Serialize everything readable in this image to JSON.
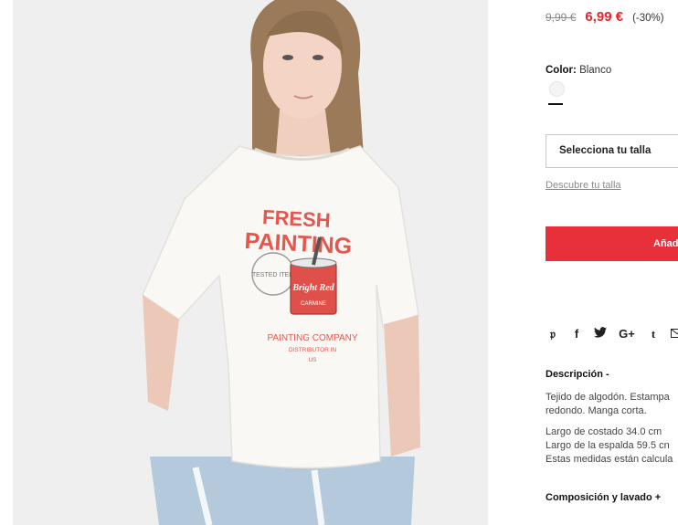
{
  "product": {
    "image_alt": "Camiseta blanca estampada Fresh Painting",
    "print_text": {
      "line1": "FRESH",
      "line2": "PAINTING",
      "can_brand": "Bright Red",
      "can_sub": "CARMINE",
      "badge": "TESTED ITEM",
      "company": "PAINTING COMPANY",
      "small1": "DISTRIBUTOR IN",
      "small2": "US"
    }
  },
  "price": {
    "old": "9,99 €",
    "new": "6,99 €",
    "discount": "(-30%)",
    "sale_color": "#e4262f"
  },
  "color": {
    "label": "Color:",
    "value": "Blanco",
    "swatch_hex": "#f4f4f6"
  },
  "size": {
    "placeholder": "Selecciona tu talla",
    "guide_link": "Descubre tu talla"
  },
  "cart": {
    "add_label": "Añad",
    "button_color": "#e8303a"
  },
  "share": {
    "icons": [
      "pinterest-icon",
      "facebook-icon",
      "twitter-icon",
      "google-plus-icon",
      "tumblr-icon",
      "email-icon"
    ]
  },
  "description": {
    "title": "Descripción -",
    "line1": "Tejido de algodón. Estampa",
    "line2": "redondo. Manga corta.",
    "line3": "Largo de costado 34.0 cm",
    "line4": "Largo de la espalda 59.5 cn",
    "line5": "Estas medidas están calcula"
  },
  "composition": {
    "title": "Composición y lavado +"
  }
}
